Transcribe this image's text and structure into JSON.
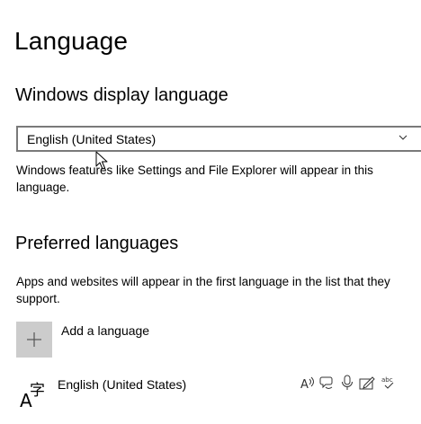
{
  "page": {
    "title": "Language"
  },
  "display_language": {
    "heading": "Windows display language",
    "selected": "English (United States)",
    "description": "Windows features like Settings and File Explorer will appear in this language."
  },
  "preferred_languages": {
    "heading": "Preferred languages",
    "description": "Apps and websites will appear in the first language in the list that they support.",
    "add_label": "Add a language",
    "items": [
      {
        "name": "English (United States)",
        "feature_icons": [
          "text-to-speech-icon",
          "speech-recognition-icon",
          "microphone-icon",
          "handwriting-icon",
          "spell-check-icon"
        ]
      }
    ]
  },
  "icons": {
    "add": "plus-icon",
    "language": "language-glyph-icon",
    "dropdown": "chevron-down-icon",
    "cursor": "mouse-cursor-icon"
  }
}
